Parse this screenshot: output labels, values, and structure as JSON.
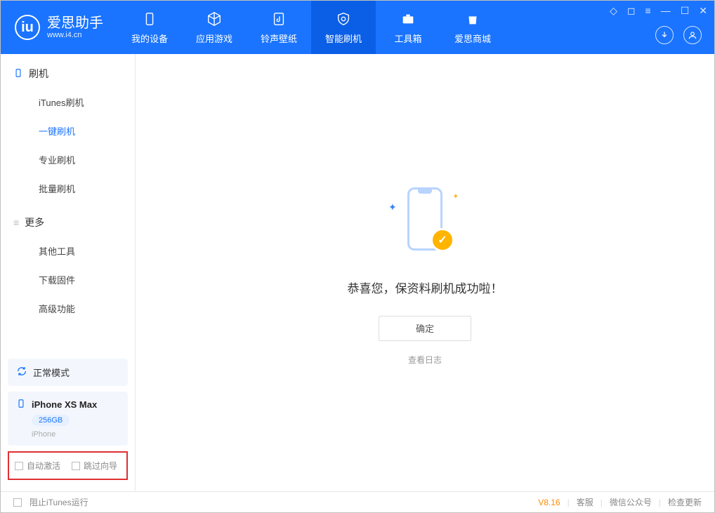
{
  "app": {
    "title": "爱思助手",
    "url": "www.i4.cn"
  },
  "nav": {
    "tabs": [
      {
        "label": "我的设备"
      },
      {
        "label": "应用游戏"
      },
      {
        "label": "铃声壁纸"
      },
      {
        "label": "智能刷机"
      },
      {
        "label": "工具箱"
      },
      {
        "label": "爱思商城"
      }
    ]
  },
  "sidebar": {
    "section1_title": "刷机",
    "section1_items": [
      {
        "label": "iTunes刷机"
      },
      {
        "label": "一键刷机"
      },
      {
        "label": "专业刷机"
      },
      {
        "label": "批量刷机"
      }
    ],
    "section2_title": "更多",
    "section2_items": [
      {
        "label": "其他工具"
      },
      {
        "label": "下载固件"
      },
      {
        "label": "高级功能"
      }
    ],
    "status_label": "正常模式",
    "device": {
      "name": "iPhone XS Max",
      "capacity": "256GB",
      "type": "iPhone"
    },
    "option_auto_activate": "自动激活",
    "option_skip_guide": "跳过向导"
  },
  "main": {
    "success_text": "恭喜您，保资料刷机成功啦！",
    "ok_button": "确定",
    "view_log": "查看日志"
  },
  "footer": {
    "block_itunes": "阻止iTunes运行",
    "version": "V8.16",
    "link_service": "客服",
    "link_wechat": "微信公众号",
    "link_update": "检查更新"
  }
}
